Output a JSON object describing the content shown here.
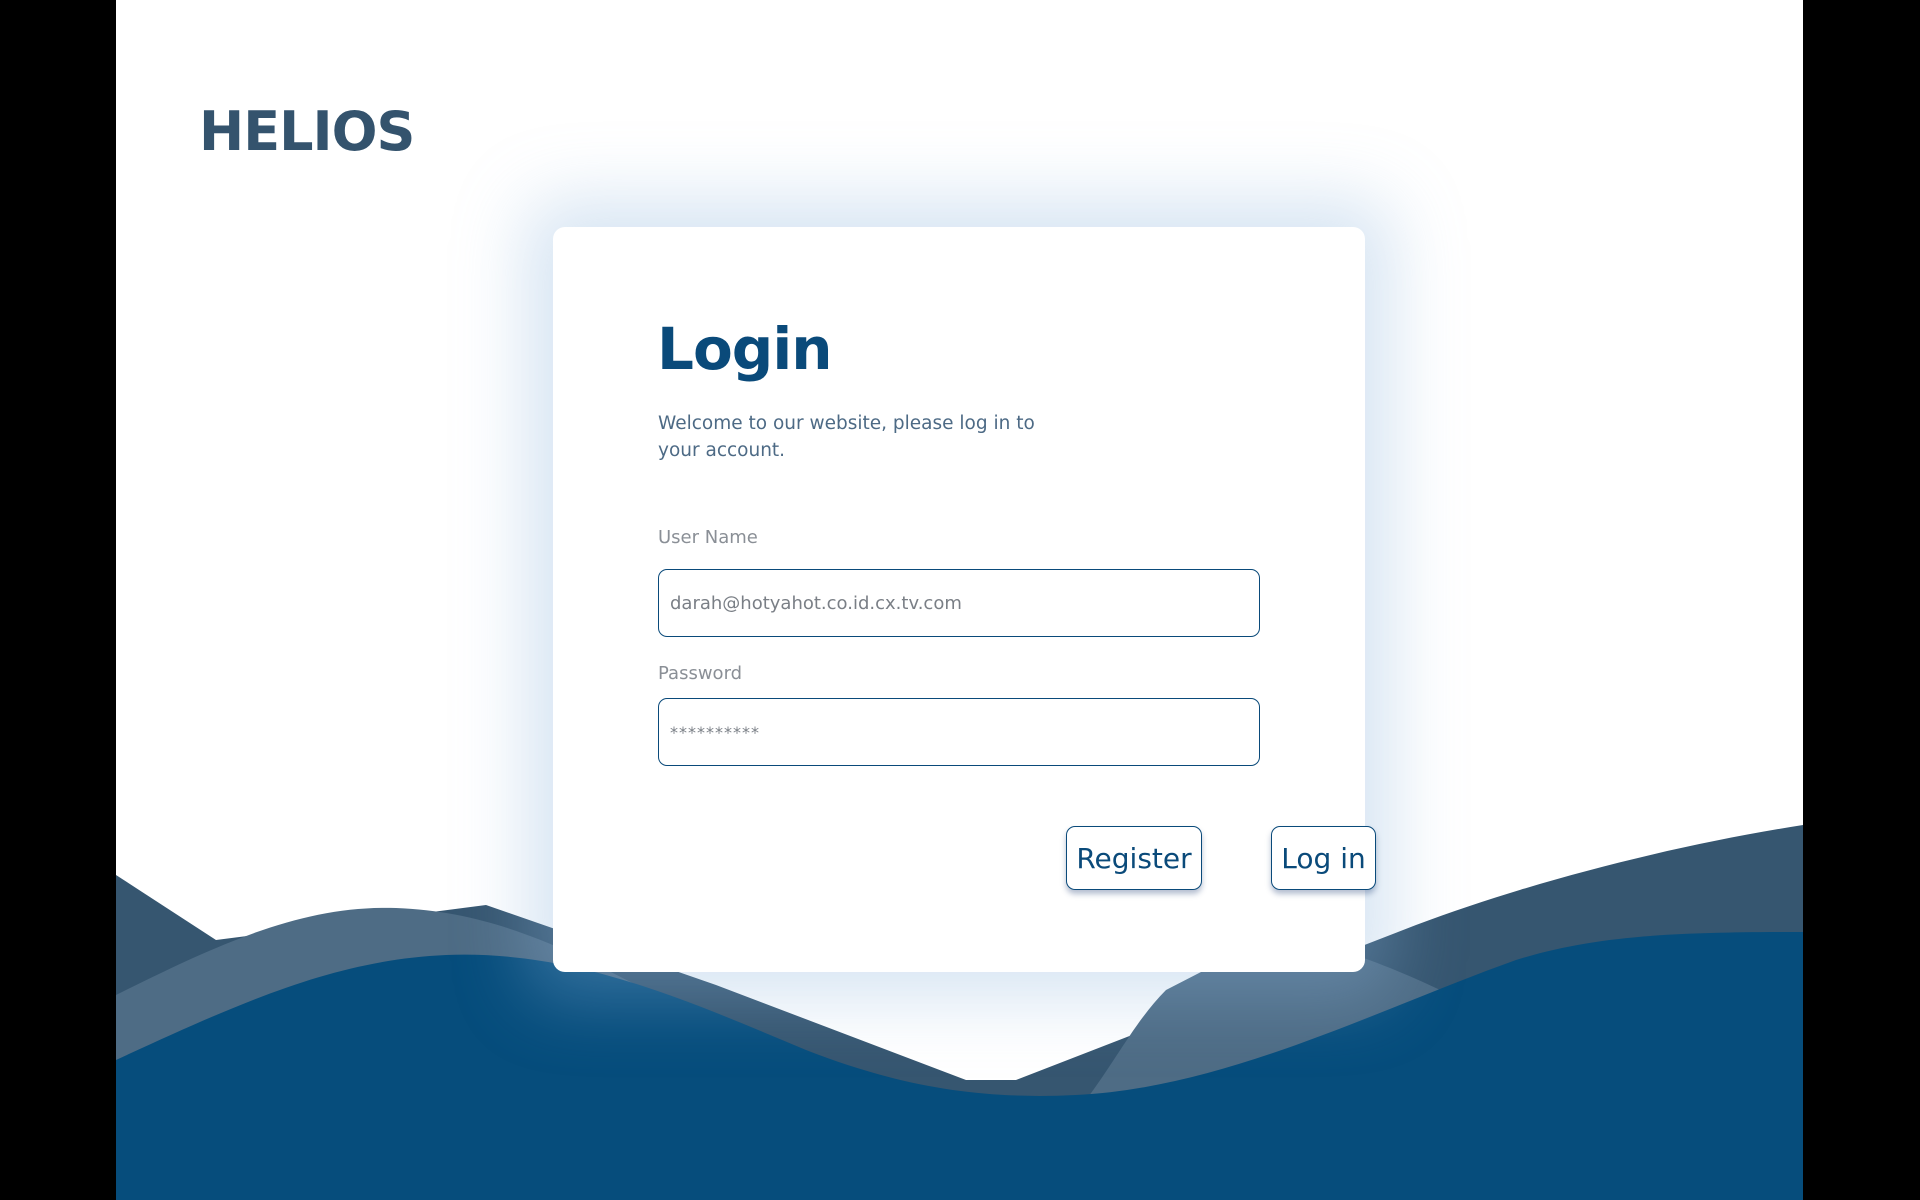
{
  "brand": {
    "name": "HELIOS"
  },
  "login": {
    "title": "Login",
    "subtitle": "Welcome to our website, please log in to your account.",
    "username_label": "User Name",
    "username_value": "darah@hotyahot.co.id.cx.tv.com",
    "password_label": "Password",
    "password_value": "**********",
    "register_label": "Register",
    "login_label": "Log in"
  },
  "colors": {
    "brand_text": "#34536d",
    "accent": "#0a4a7a",
    "wave_dark": "#365670",
    "wave_mid": "#4e6c85",
    "wave_front": "#064d7c",
    "background": "#ffffff"
  }
}
